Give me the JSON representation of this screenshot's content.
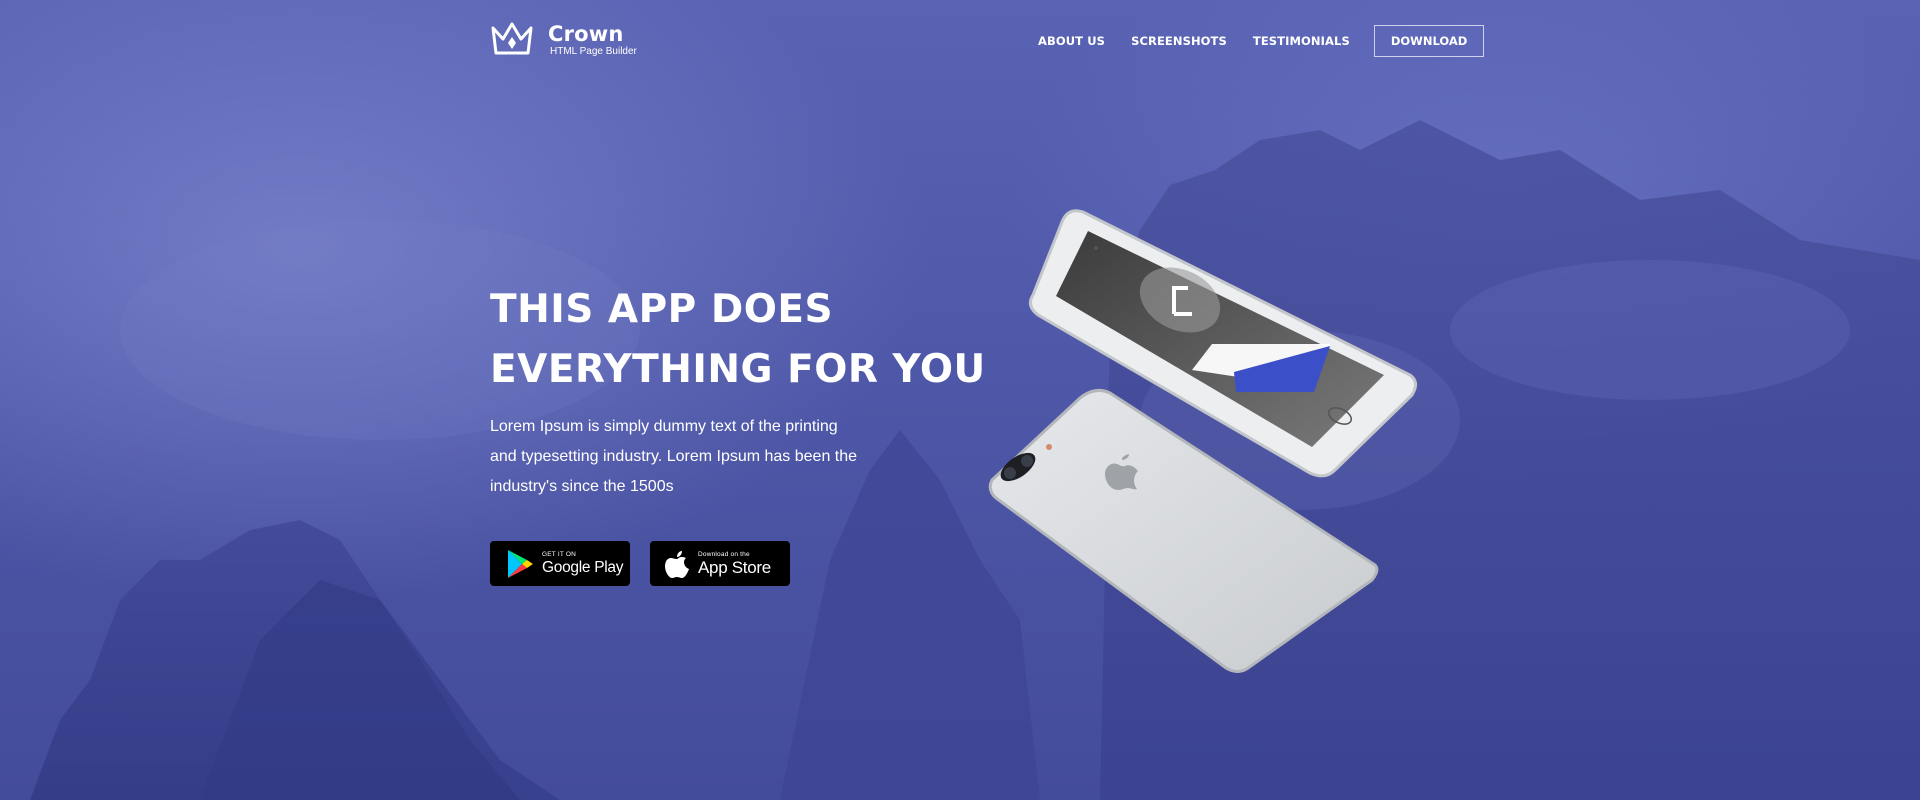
{
  "header": {
    "brand": "Crown",
    "tagline": "HTML Page Builder",
    "logo_icon": "crown-icon",
    "nav": [
      {
        "label": "ABOUT US"
      },
      {
        "label": "SCREENSHOTS"
      },
      {
        "label": "TESTIMONIALS"
      }
    ],
    "download_label": "DOWNLOAD"
  },
  "hero": {
    "headline_line1": "THIS APP DOES",
    "headline_line2": "EVERYTHING FOR YOU",
    "description_line1": "Lorem Ipsum is simply dummy text of the printing",
    "description_line2": "and typesetting industry. Lorem Ipsum has been the",
    "description_line3": "industry's since the 1500s",
    "google_play": {
      "small": "GET IT ON",
      "big": "Google Play",
      "icon": "google-play-icon"
    },
    "app_store": {
      "small": "Download on the",
      "big": "App Store",
      "icon": "apple-icon"
    }
  },
  "colors": {
    "background": "#4f58a8",
    "accent_blue": "#3a4fc8",
    "text": "#ffffff",
    "button_bg": "#000000"
  }
}
